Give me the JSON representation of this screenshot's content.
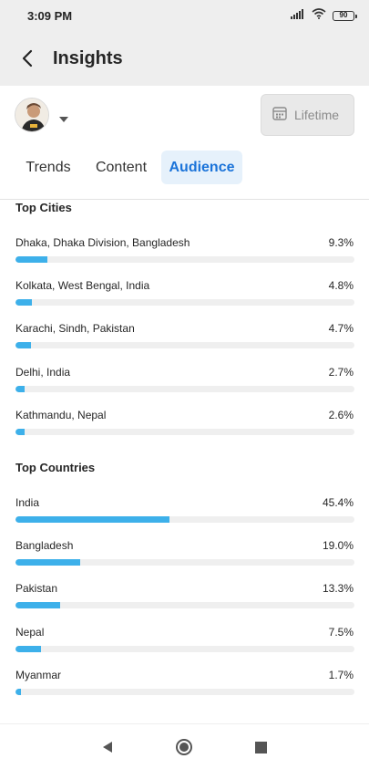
{
  "status": {
    "time": "3:09 PM",
    "battery": "90"
  },
  "header": {
    "title": "Insights"
  },
  "filter": {
    "period_label": "Lifetime"
  },
  "tabs": [
    {
      "label": "Trends",
      "active": false
    },
    {
      "label": "Content",
      "active": false
    },
    {
      "label": "Audience",
      "active": true
    }
  ],
  "cities": {
    "title": "Top Cities",
    "rows": [
      {
        "name": "Dhaka, Dhaka Division, Bangladesh",
        "value": "9.3%",
        "pct": 9.3
      },
      {
        "name": "Kolkata, West Bengal, India",
        "value": "4.8%",
        "pct": 4.8
      },
      {
        "name": "Karachi, Sindh, Pakistan",
        "value": "4.7%",
        "pct": 4.7
      },
      {
        "name": "Delhi, India",
        "value": "2.7%",
        "pct": 2.7
      },
      {
        "name": "Kathmandu, Nepal",
        "value": "2.6%",
        "pct": 2.6
      }
    ]
  },
  "countries": {
    "title": "Top Countries",
    "rows": [
      {
        "name": "India",
        "value": "45.4%",
        "pct": 45.4
      },
      {
        "name": "Bangladesh",
        "value": "19.0%",
        "pct": 19.0
      },
      {
        "name": "Pakistan",
        "value": "13.3%",
        "pct": 13.3
      },
      {
        "name": "Nepal",
        "value": "7.5%",
        "pct": 7.5
      },
      {
        "name": "Myanmar",
        "value": "1.7%",
        "pct": 1.7
      }
    ]
  },
  "colors": {
    "accent": "#1a73d9",
    "bar": "#3db0ea",
    "track": "#efefef",
    "active_tab_bg": "#e6f1fb"
  },
  "icons": {
    "back": "back-arrow-icon",
    "calendar": "calendar-icon",
    "caret": "caret-down-icon",
    "nav_back": "nav-back-icon",
    "nav_home": "nav-home-icon",
    "nav_recents": "nav-recents-icon"
  }
}
